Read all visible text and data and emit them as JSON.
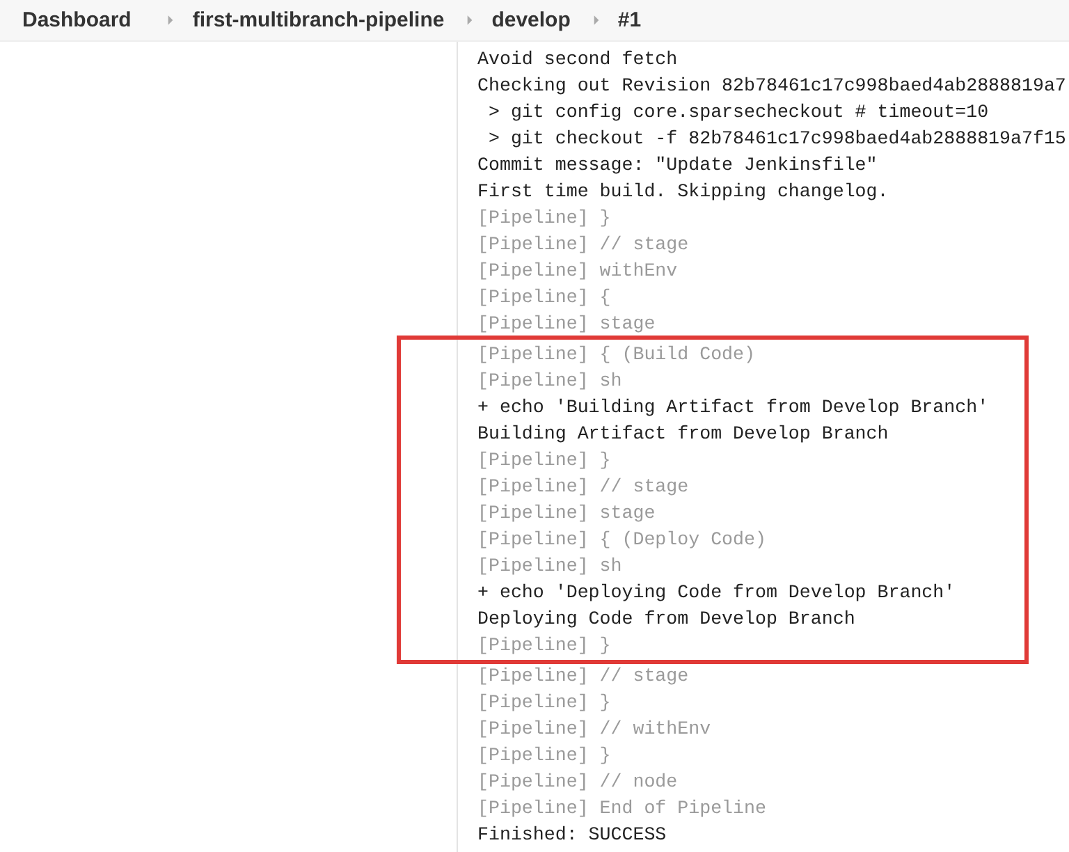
{
  "breadcrumbs": [
    {
      "label": "Dashboard"
    },
    {
      "label": "first-multibranch-pipeline"
    },
    {
      "label": "develop"
    },
    {
      "label": "#1"
    }
  ],
  "console": {
    "before": [
      {
        "text": "Avoid second fetch",
        "kind": "output"
      },
      {
        "text": "Checking out Revision 82b78461c17c998baed4ab2888819a7",
        "kind": "output"
      },
      {
        "text": " > git config core.sparsecheckout # timeout=10",
        "kind": "output"
      },
      {
        "text": " > git checkout -f 82b78461c17c998baed4ab2888819a7f15",
        "kind": "output"
      },
      {
        "text": "Commit message: \"Update Jenkinsfile\"",
        "kind": "output"
      },
      {
        "text": "First time build. Skipping changelog.",
        "kind": "output"
      },
      {
        "text": "[Pipeline] }",
        "kind": "pipeline"
      },
      {
        "text": "[Pipeline] // stage",
        "kind": "pipeline"
      },
      {
        "text": "[Pipeline] withEnv",
        "kind": "pipeline"
      },
      {
        "text": "[Pipeline] {",
        "kind": "pipeline"
      },
      {
        "text": "[Pipeline] stage",
        "kind": "pipeline"
      }
    ],
    "highlighted": [
      {
        "text": "[Pipeline] { (Build Code)",
        "kind": "pipeline"
      },
      {
        "text": "[Pipeline] sh",
        "kind": "pipeline"
      },
      {
        "text": "+ echo 'Building Artifact from Develop Branch'",
        "kind": "output"
      },
      {
        "text": "Building Artifact from Develop Branch",
        "kind": "output"
      },
      {
        "text": "[Pipeline] }",
        "kind": "pipeline"
      },
      {
        "text": "[Pipeline] // stage",
        "kind": "pipeline"
      },
      {
        "text": "[Pipeline] stage",
        "kind": "pipeline"
      },
      {
        "text": "[Pipeline] { (Deploy Code)",
        "kind": "pipeline"
      },
      {
        "text": "[Pipeline] sh",
        "kind": "pipeline"
      },
      {
        "text": "+ echo 'Deploying Code from Develop Branch'",
        "kind": "output"
      },
      {
        "text": "Deploying Code from Develop Branch",
        "kind": "output"
      },
      {
        "text": "[Pipeline] }",
        "kind": "pipeline"
      }
    ],
    "after": [
      {
        "text": "[Pipeline] // stage",
        "kind": "pipeline"
      },
      {
        "text": "[Pipeline] }",
        "kind": "pipeline"
      },
      {
        "text": "[Pipeline] // withEnv",
        "kind": "pipeline"
      },
      {
        "text": "[Pipeline] }",
        "kind": "pipeline"
      },
      {
        "text": "[Pipeline] // node",
        "kind": "pipeline"
      },
      {
        "text": "[Pipeline] End of Pipeline",
        "kind": "pipeline"
      },
      {
        "text": "Finished: SUCCESS",
        "kind": "output"
      }
    ]
  }
}
